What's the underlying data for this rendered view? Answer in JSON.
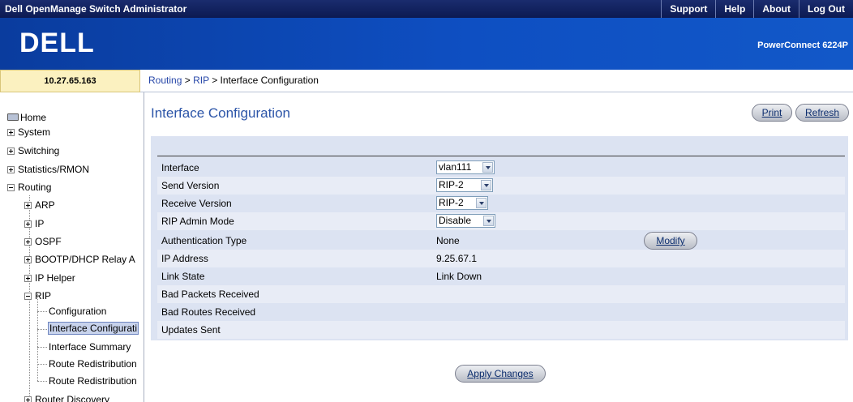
{
  "topbar": {
    "app_title": "Dell OpenManage Switch Administrator",
    "nav": [
      "Support",
      "Help",
      "About",
      "Log Out"
    ]
  },
  "banner": {
    "logo_text": "DELL",
    "model": "PowerConnect 6224P"
  },
  "ip_address": "10.27.65.163",
  "breadcrumb": {
    "routing": "Routing",
    "sep1": " > ",
    "rip": "RIP",
    "sep2": " > ",
    "current": "Interface Configuration"
  },
  "sidebar": {
    "home": "Home",
    "system": "System",
    "switching": "Switching",
    "statistics": "Statistics/RMON",
    "routing": "Routing",
    "arp": "ARP",
    "ip": "IP",
    "ospf": "OSPF",
    "bootp": "BOOTP/DHCP Relay A",
    "ip_helper": "IP Helper",
    "rip": "RIP",
    "configuration": "Configuration",
    "interface_config": "Interface Configurati",
    "interface_summary": "Interface Summary",
    "route_redist_1": "Route Redistribution",
    "route_redist_2": "Route Redistribution",
    "router_discovery": "Router Discovery"
  },
  "page": {
    "title": "Interface Configuration",
    "print": "Print",
    "refresh": "Refresh",
    "apply": "Apply Changes",
    "modify": "Modify"
  },
  "form": {
    "interface": {
      "label": "Interface",
      "value": "vlan111"
    },
    "send_version": {
      "label": "Send Version",
      "value": "RIP-2"
    },
    "receive_version": {
      "label": "Receive Version",
      "value": "RIP-2"
    },
    "admin_mode": {
      "label": "RIP Admin Mode",
      "value": "Disable"
    },
    "auth_type": {
      "label": "Authentication Type",
      "value": "None"
    },
    "ip_address": {
      "label": "IP Address",
      "value": "9.25.67.1"
    },
    "link_state": {
      "label": "Link State",
      "value": "Link Down"
    },
    "bad_packets": {
      "label": "Bad Packets Received",
      "value": ""
    },
    "bad_routes": {
      "label": "Bad Routes Received",
      "value": ""
    },
    "updates_sent": {
      "label": "Updates Sent",
      "value": ""
    }
  }
}
